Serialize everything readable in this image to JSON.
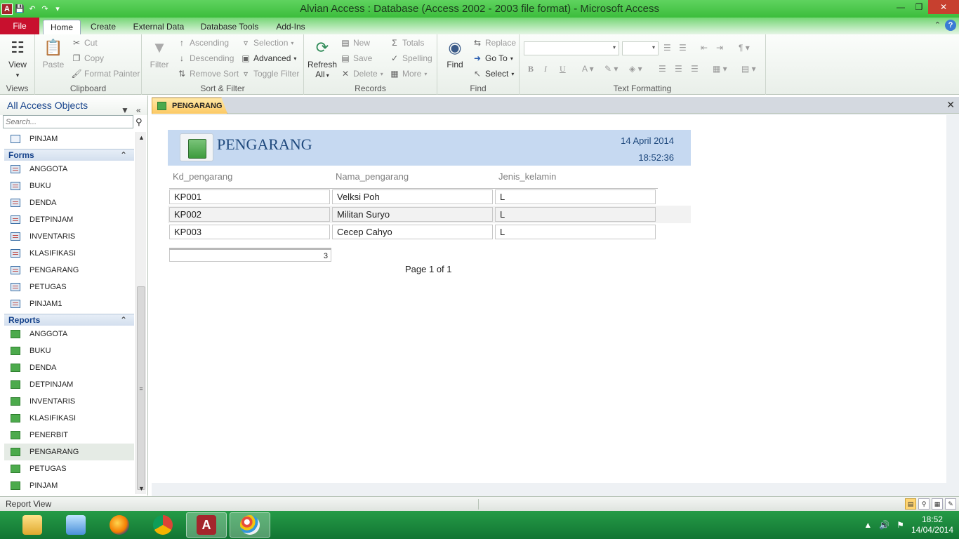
{
  "window": {
    "title": "Alvian Access : Database (Access 2002 - 2003 file format)  -  Microsoft Access"
  },
  "ribbon_tabs": [
    "File",
    "Home",
    "Create",
    "External Data",
    "Database Tools",
    "Add-Ins"
  ],
  "ribbon": {
    "views": {
      "view_label": "View",
      "group": "Views"
    },
    "clipboard": {
      "paste": "Paste",
      "cut": "Cut",
      "copy": "Copy",
      "format_painter": "Format Painter",
      "group": "Clipboard"
    },
    "sort_filter": {
      "filter": "Filter",
      "ascending": "Ascending",
      "descending": "Descending",
      "remove_sort": "Remove Sort",
      "selection": "Selection",
      "advanced": "Advanced",
      "toggle_filter": "Toggle Filter",
      "group": "Sort & Filter"
    },
    "records": {
      "refresh": "Refresh",
      "refresh_all": "All",
      "new": "New",
      "save": "Save",
      "delete": "Delete",
      "totals": "Totals",
      "spelling": "Spelling",
      "more": "More",
      "group": "Records"
    },
    "find": {
      "find": "Find",
      "replace": "Replace",
      "goto": "Go To",
      "select": "Select",
      "group": "Find"
    },
    "text_formatting": {
      "group": "Text Formatting"
    }
  },
  "nav": {
    "header": "All Access Objects",
    "search_placeholder": "Search...",
    "table_item": "PINJAM",
    "forms_label": "Forms",
    "forms": [
      "ANGGOTA",
      "BUKU",
      "DENDA",
      "DETPINJAM",
      "INVENTARIS",
      "KLASIFIKASI",
      "PENGARANG",
      "PETUGAS",
      "PINJAM1"
    ],
    "reports_label": "Reports",
    "reports": [
      "ANGGOTA",
      "BUKU",
      "DENDA",
      "DETPINJAM",
      "INVENTARIS",
      "KLASIFIKASI",
      "PENERBIT",
      "PENGARANG",
      "PETUGAS",
      "PINJAM"
    ],
    "selected_report": "PENGARANG"
  },
  "doc_tab": "PENGARANG",
  "report": {
    "title": "PENGARANG",
    "date": "14 April 2014",
    "time": "18:52:36",
    "columns": [
      "Kd_pengarang",
      "Nama_pengarang",
      "Jenis_kelamin"
    ],
    "rows": [
      [
        "KP001",
        "Velksi Poh",
        "L"
      ],
      [
        "KP002",
        "Militan Suryo",
        "L"
      ],
      [
        "KP003",
        "Cecep Cahyo",
        "L"
      ]
    ],
    "count": "3",
    "footer": "Page 1 of 1"
  },
  "status": {
    "text": "Report View"
  },
  "clock": {
    "time": "18:52",
    "date": "14/04/2014"
  }
}
